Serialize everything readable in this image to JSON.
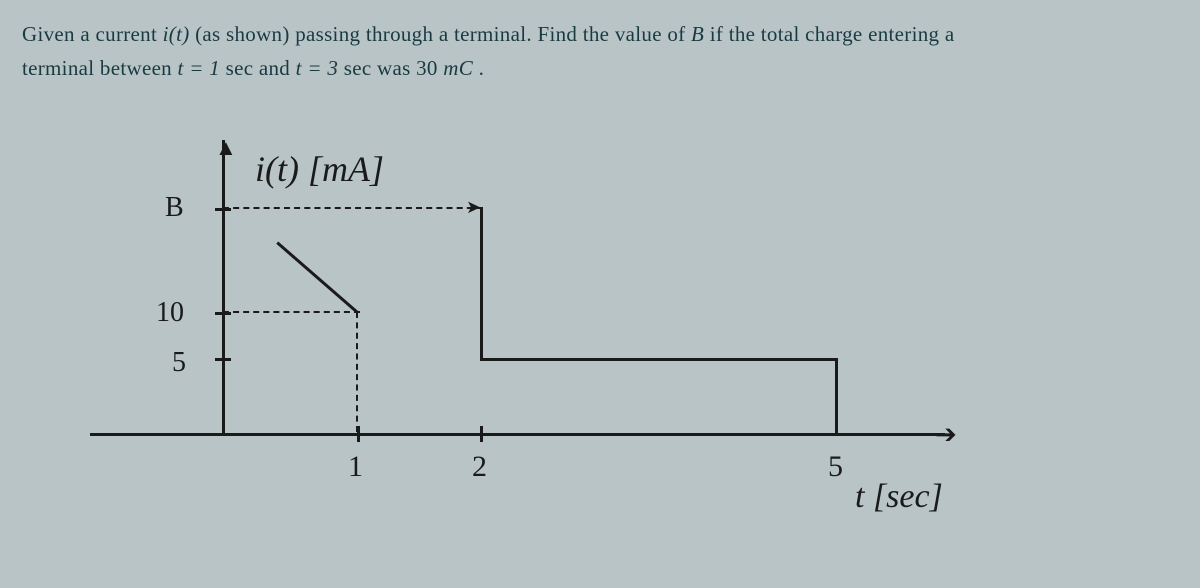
{
  "problem": {
    "line1_pre": "Given a current ",
    "i_of_t": "i(t)",
    "line1_mid": " (as shown) passing through a terminal. Find the value of ",
    "B": "B",
    "line1_post": " if the total charge entering a",
    "line2_pre": "terminal between ",
    "t1": "t = 1",
    "sec1": " sec and ",
    "t3": "t = 3",
    "line2_post": " sec was 30 ",
    "unit": "mC",
    "period": " ."
  },
  "graph": {
    "y_axis_title": "i(t)   [mA]",
    "x_axis_title": "t [sec]",
    "y_ticks": {
      "B": "B",
      "v10": "10",
      "v5": "5"
    },
    "x_ticks": {
      "v1": "1",
      "v2": "2",
      "v5": "5"
    }
  },
  "chart_data": {
    "type": "line",
    "title": "i(t) [mA]",
    "xlabel": "t [sec]",
    "ylabel": "i(t) [mA]",
    "x_ticks": [
      1,
      2,
      5
    ],
    "y_ticks": [
      5,
      10,
      "B"
    ],
    "series": [
      {
        "name": "i(t)",
        "segments": [
          {
            "from": {
              "t": 0,
              "i": "B"
            },
            "to": {
              "t": 1,
              "i": "B"
            },
            "style": "dashed/constant"
          },
          {
            "from": {
              "t": 1,
              "i": 10
            },
            "to": {
              "t": 2,
              "i": "B"
            },
            "style": "ramp"
          },
          {
            "from": {
              "t": 2,
              "i": 5
            },
            "to": {
              "t": 5,
              "i": 5
            },
            "style": "constant"
          },
          {
            "from": {
              "t": 5,
              "i": 5
            },
            "to": {
              "t": 5,
              "i": 0
            },
            "style": "drop"
          }
        ]
      }
    ],
    "annotations": [
      "dashed guide at y=B to x=2",
      "dashed guide at y=10 to x=1",
      "vertical drop at x=2 from B to 5"
    ]
  }
}
